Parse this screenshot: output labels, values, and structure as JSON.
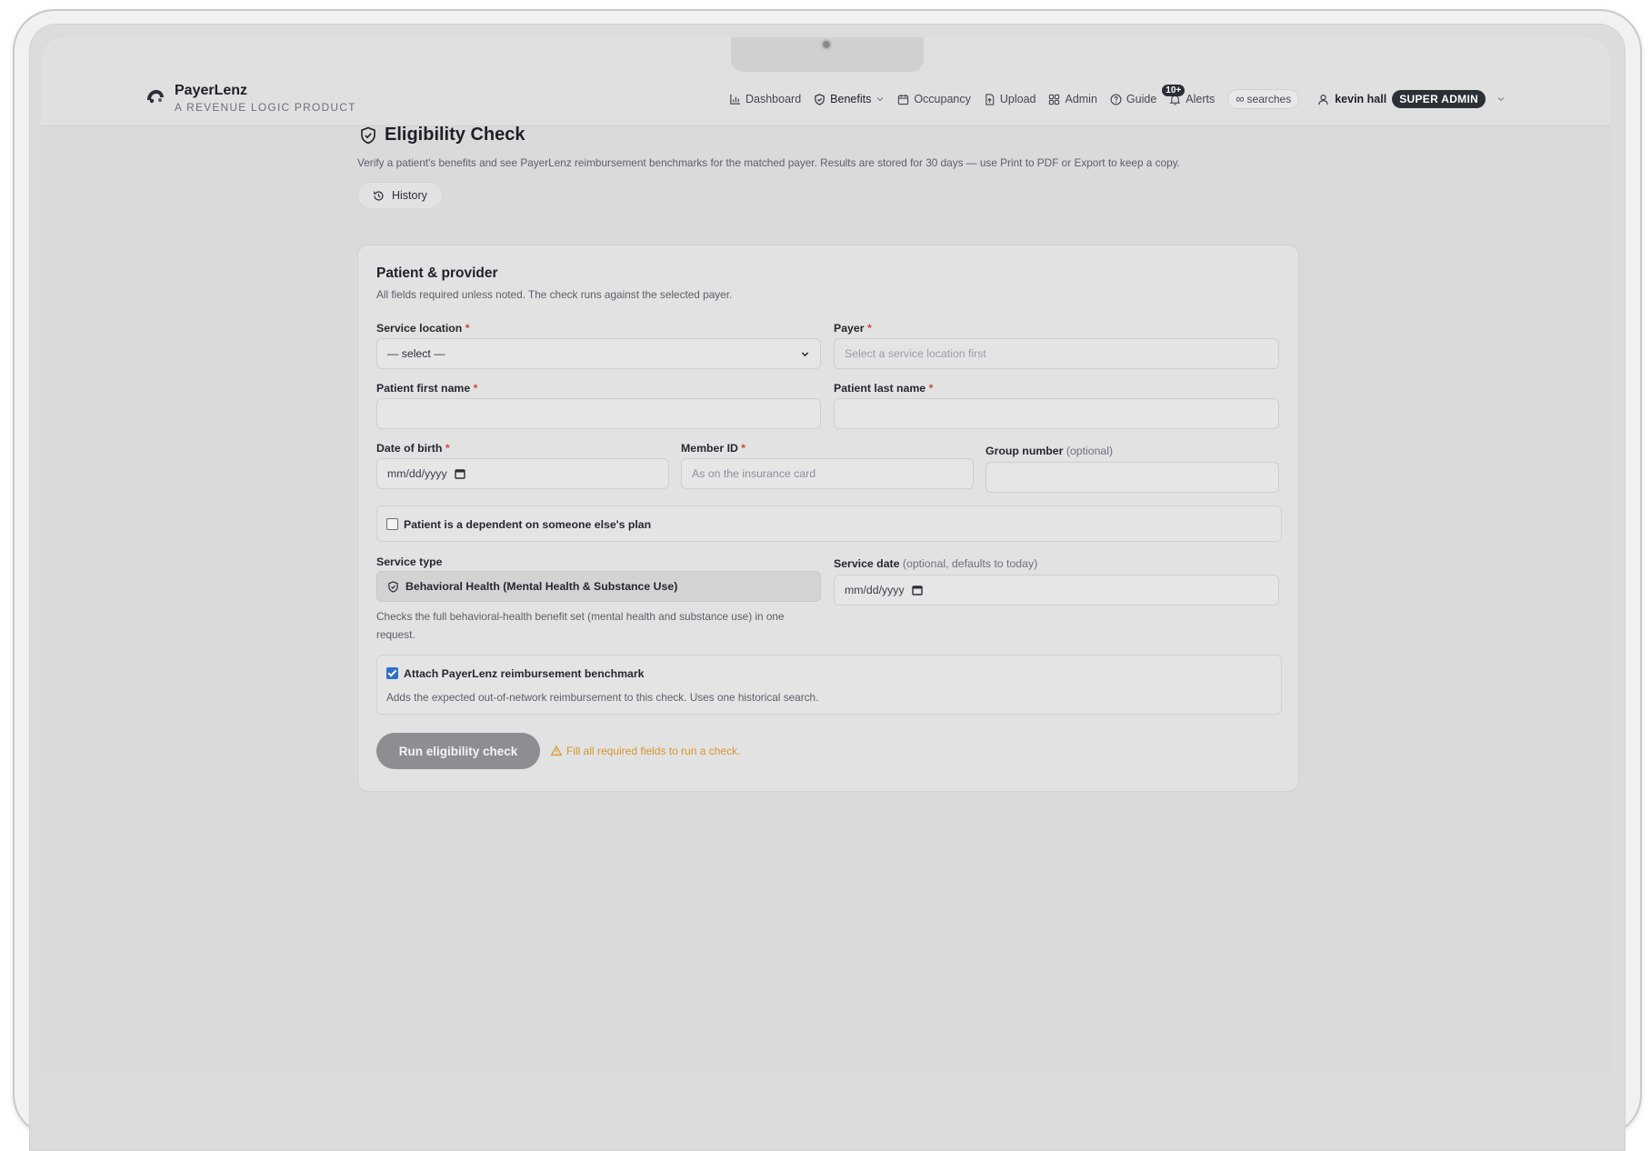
{
  "brand": {
    "name": "PayerLenz",
    "tagline": "A REVENUE LOGIC PRODUCT"
  },
  "nav": {
    "dashboard": "Dashboard",
    "benefits": "Benefits",
    "occupancy": "Occupancy",
    "upload": "Upload",
    "admin": "Admin",
    "guide": "Guide",
    "alerts": "Alerts",
    "alerts_badge": "10+",
    "searches": "searches"
  },
  "user": {
    "name": "kevin hall",
    "role": "SUPER ADMIN"
  },
  "page": {
    "title": "Eligibility Check",
    "description": "Verify a patient's benefits and see PayerLenz reimbursement benchmarks for the matched payer. Results are stored for 30 days — use Print to PDF or Export to keep a copy.",
    "history_label": "History"
  },
  "form": {
    "title": "Patient & provider",
    "subtitle": "All fields required unless noted. The check runs against the selected payer.",
    "service_location": {
      "label": "Service location",
      "value": "— select —"
    },
    "payer": {
      "label": "Payer",
      "placeholder": "Select a service location first"
    },
    "first_name": {
      "label": "Patient first name",
      "value": ""
    },
    "last_name": {
      "label": "Patient last name",
      "value": ""
    },
    "dob": {
      "label": "Date of birth",
      "placeholder": "mm/dd/yyyy"
    },
    "member_id": {
      "label": "Member ID",
      "placeholder": "As on the insurance card"
    },
    "group_number": {
      "label": "Group number",
      "optional": "(optional)",
      "value": ""
    },
    "dependent": {
      "label": "Patient is a dependent on someone else's plan",
      "checked": false
    },
    "service_type": {
      "label": "Service type",
      "value": "Behavioral Health (Mental Health & Substance Use)",
      "help": "Checks the full behavioral-health benefit set (mental health and substance use) in one request."
    },
    "service_date": {
      "label": "Service date",
      "optional": "(optional, defaults to today)",
      "placeholder": "mm/dd/yyyy"
    },
    "benchmark": {
      "label": "Attach PayerLenz reimbursement benchmark",
      "help": "Adds the expected out-of-network reimbursement to this check. Uses one historical search.",
      "checked": true
    },
    "required_mark": "*",
    "run_button": "Run eligibility check",
    "warning": "Fill all required fields to run a check."
  },
  "colors": {
    "accent": "#2f6fc4",
    "warning": "#d8962a",
    "required": "#d0453a",
    "badge": "#2b2f36"
  }
}
